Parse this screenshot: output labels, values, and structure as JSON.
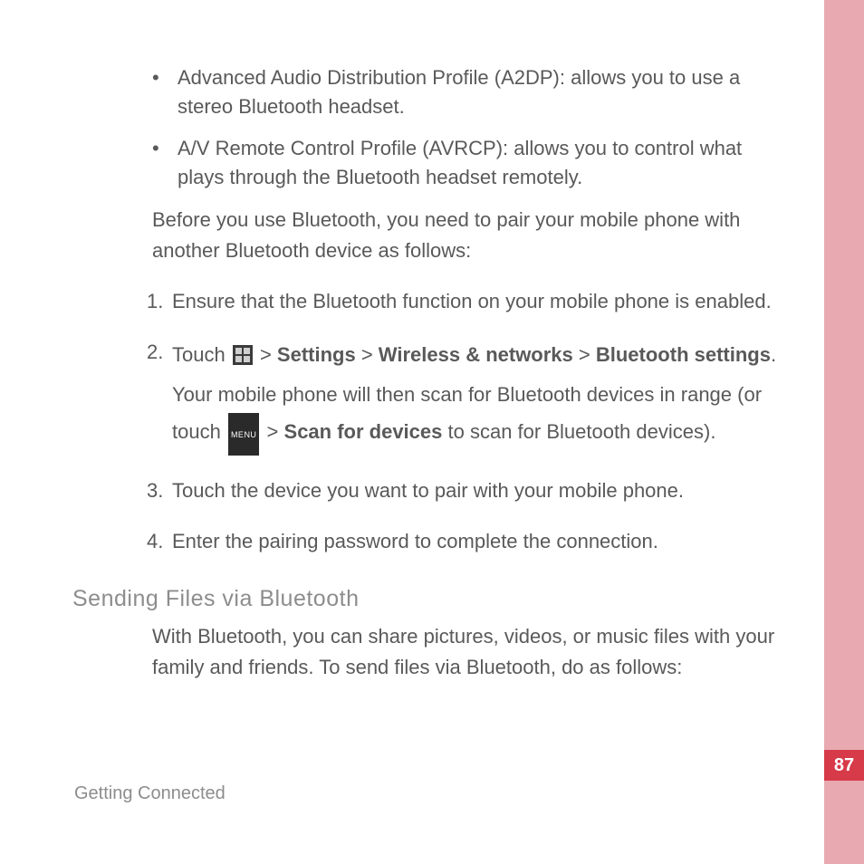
{
  "bullets": {
    "b1": "Advanced Audio Distribution Profile (A2DP): allows you to use a stereo Bluetooth headset.",
    "b2": "A/V Remote Control Profile (AVRCP): allows you to control what plays through the Bluetooth headset remotely."
  },
  "intro_para": "Before you use Bluetooth, you need to pair your mobile phone with another Bluetooth device as follows:",
  "steps": {
    "s1_num": "1.",
    "s1": "Ensure that the Bluetooth function on your mobile phone is enabled.",
    "s2_num": "2.",
    "s2_a": "Touch ",
    "s2_gt1": " > ",
    "s2_settings": "Settings",
    "s2_gt2": " > ",
    "s2_wireless": "Wireless & networks",
    "s2_gt3": " > ",
    "s2_bts": "Bluetooth settings",
    "s2_b": ". Your mobile phone will then scan for Bluetooth devices in range (or touch ",
    "s2_gt4": " > ",
    "s2_scan": "Scan for devices",
    "s2_c": " to scan for Bluetooth devices).",
    "s3_num": "3.",
    "s3": "Touch the device you want to pair with your mobile phone.",
    "s4_num": "4.",
    "s4": "Enter the pairing password to complete the connection."
  },
  "heading": "Sending Files via Bluetooth",
  "heading_para": "With Bluetooth, you can share pictures, videos, or music files with your family and friends. To send files via Bluetooth, do as follows:",
  "footer": "Getting Connected",
  "page_number": "87",
  "icons": {
    "menu_label": "MENU"
  }
}
